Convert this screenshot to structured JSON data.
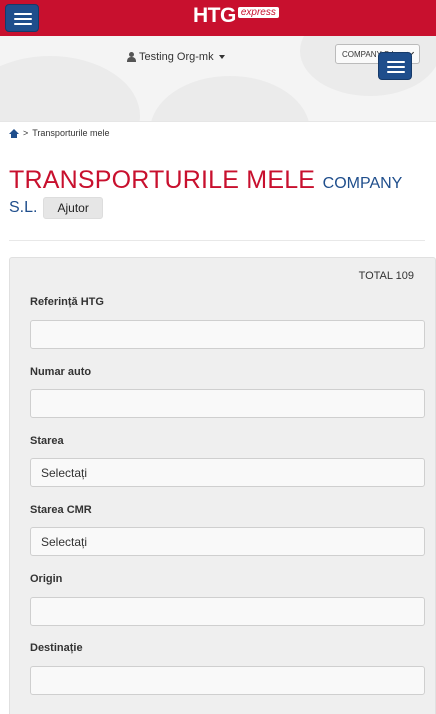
{
  "header": {
    "logo_main": "HTG",
    "logo_sub": "express"
  },
  "subheader": {
    "user_label": "Testing Org-mk",
    "company_selected": "COMPANY S.L."
  },
  "breadcrumb": {
    "separator": ">",
    "current": "Transporturile mele"
  },
  "page": {
    "title": "TRANSPORTURILE MELE",
    "company_part1": "COMPANY",
    "company_part2": "S.L.",
    "help_label": "Ajutor"
  },
  "filters": {
    "total": "TOTAL 109",
    "fields": [
      {
        "label": "Referință HTG",
        "value": ""
      },
      {
        "label": "Numar auto",
        "value": ""
      },
      {
        "label": "Starea",
        "value": "Selectați"
      },
      {
        "label": "Starea CMR",
        "value": "Selectați"
      },
      {
        "label": "Origin",
        "value": ""
      },
      {
        "label": "Destinație",
        "value": ""
      }
    ]
  },
  "colors": {
    "brand_red": "#c8102e",
    "brand_blue": "#1f4e8c"
  }
}
